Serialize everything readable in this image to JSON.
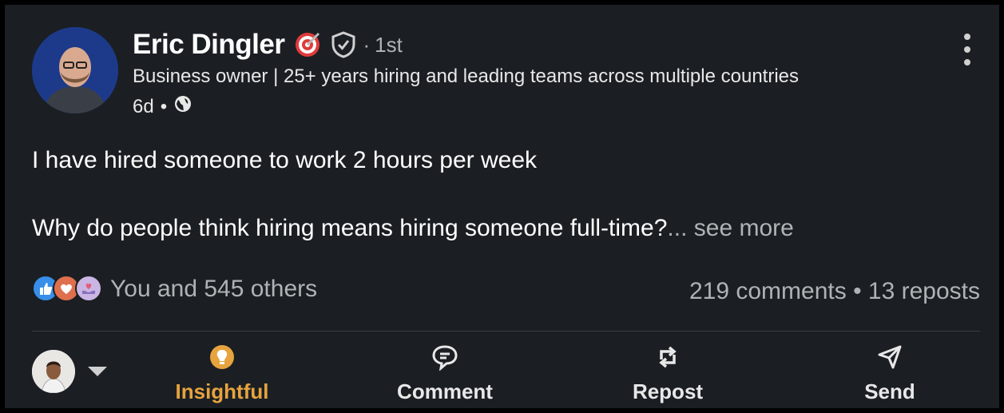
{
  "post": {
    "author_name": "Eric Dingler",
    "connection_degree": "1st",
    "headline": "Business owner | 25+ years hiring and leading teams across multiple countries",
    "time_ago": "6d",
    "body_line_1": "I have hired someone to work 2 hours per week",
    "body_line_2": "Why do people think hiring means hiring someone full-time?",
    "see_more": "... see more"
  },
  "social": {
    "reactions_text": "You and 545 others",
    "stats_text": "219 comments • 13 reposts"
  },
  "actions": [
    {
      "label": "Insightful",
      "icon": "lightbulb-icon",
      "active": true
    },
    {
      "label": "Comment",
      "icon": "comment-icon",
      "active": false
    },
    {
      "label": "Repost",
      "icon": "repost-icon",
      "active": false
    },
    {
      "label": "Send",
      "icon": "send-icon",
      "active": false
    }
  ],
  "colors": {
    "background": "#1b1f23",
    "accent_insightful": "#e7a33e",
    "muted_text": "#b0b3b6"
  }
}
